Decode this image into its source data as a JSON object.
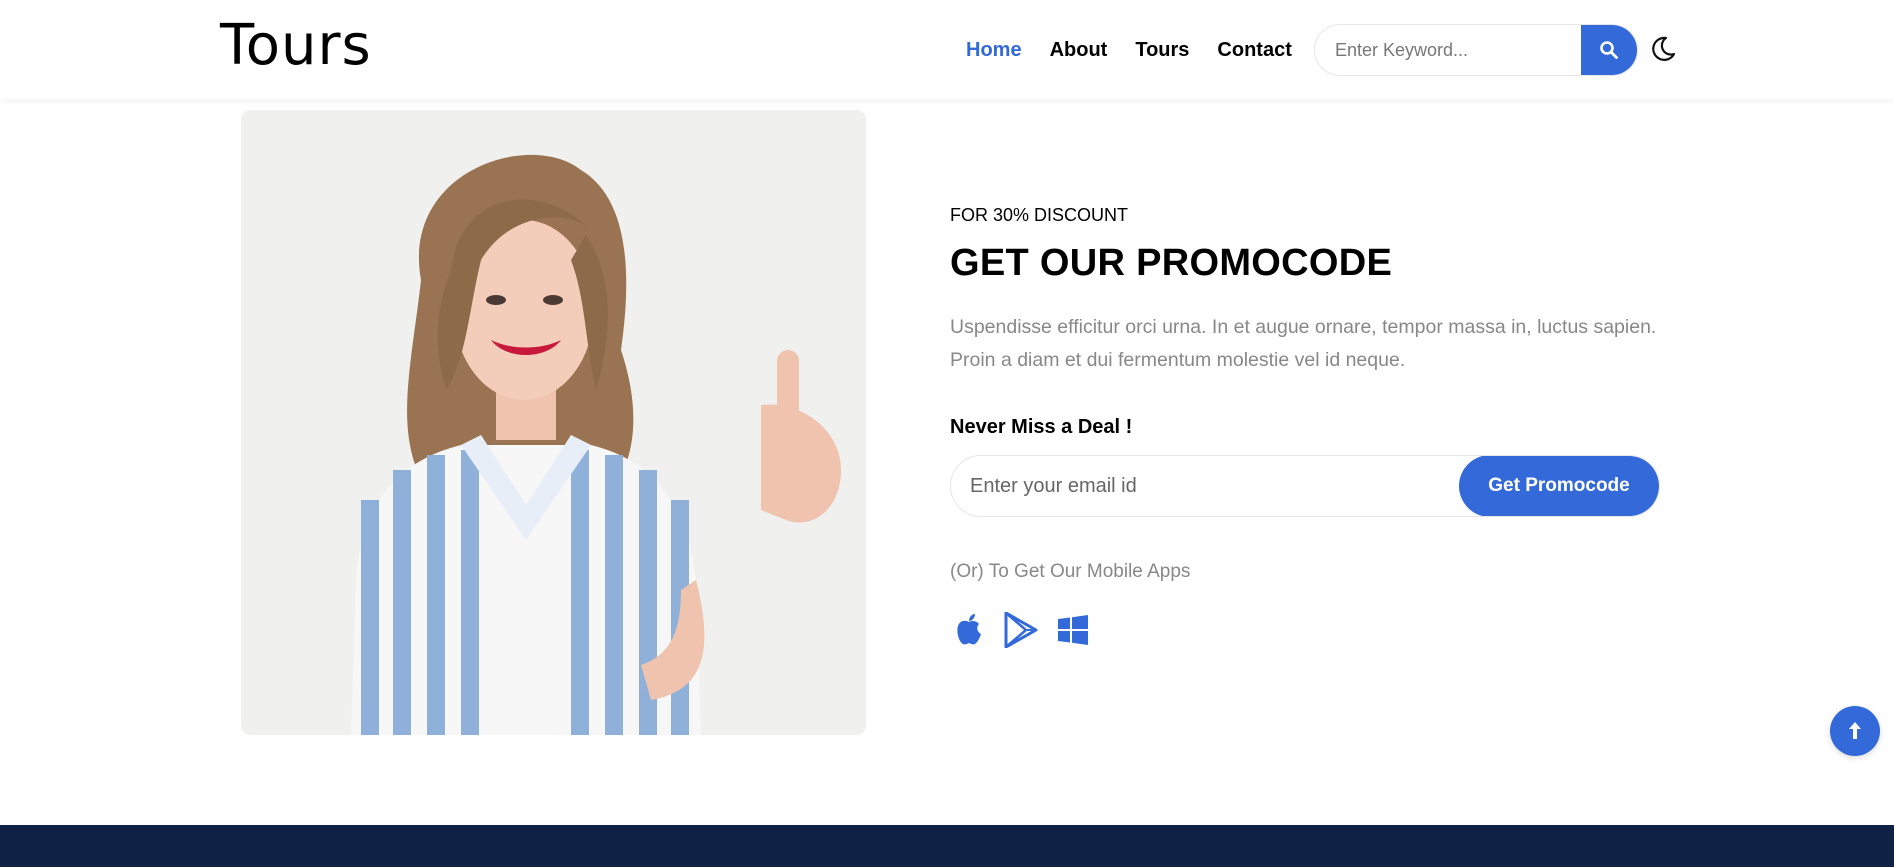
{
  "header": {
    "logo": "Tours",
    "nav": [
      {
        "label": "Home",
        "active": true
      },
      {
        "label": "About",
        "active": false
      },
      {
        "label": "Tours",
        "active": false
      },
      {
        "label": "Contact",
        "active": false
      }
    ],
    "search_placeholder": "Enter Keyword...",
    "search_icon": "search-icon",
    "theme_icon": "moon-icon"
  },
  "promo": {
    "eyebrow": "FOR 30% DISCOUNT",
    "title": "GET OUR PROMOCODE",
    "description": "Uspendisse efficitur orci urna. In et augue ornare, tempor massa in, luctus sapien. Proin a diam et dui fermentum molestie vel id neque.",
    "deal_label": "Never Miss a Deal !",
    "email_placeholder": "Enter your email id",
    "button_label": "Get Promocode",
    "apps_text": "(Or) To Get Our Mobile Apps",
    "app_icons": [
      "apple-icon",
      "google-play-icon",
      "windows-icon"
    ]
  },
  "colors": {
    "accent": "#3369d8",
    "footer": "#0f2144",
    "muted_text": "#888888"
  },
  "back_to_top_icon": "arrow-up-icon"
}
